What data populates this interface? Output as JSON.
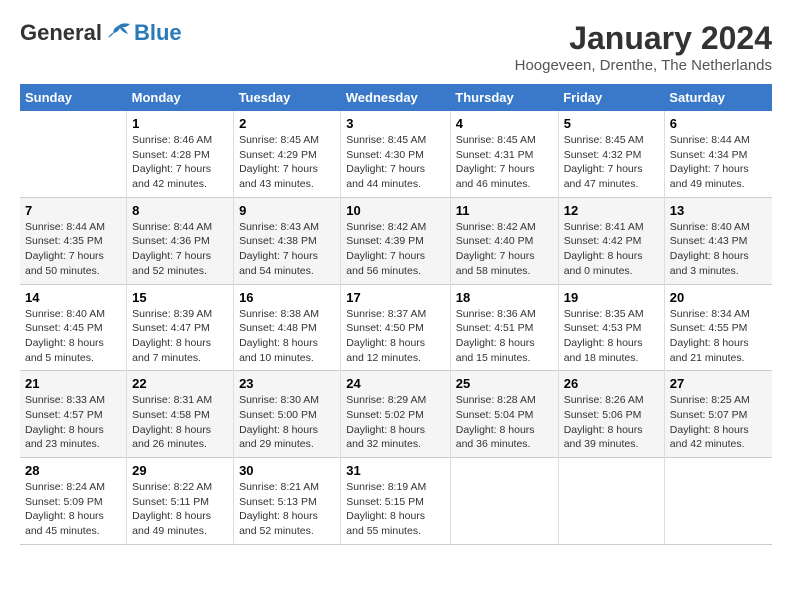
{
  "logo": {
    "general": "General",
    "blue": "Blue"
  },
  "header": {
    "month": "January 2024",
    "location": "Hoogeveen, Drenthe, The Netherlands"
  },
  "weekdays": [
    "Sunday",
    "Monday",
    "Tuesday",
    "Wednesday",
    "Thursday",
    "Friday",
    "Saturday"
  ],
  "weeks": [
    [
      {
        "day": "",
        "sunrise": "",
        "sunset": "",
        "daylight": ""
      },
      {
        "day": "1",
        "sunrise": "Sunrise: 8:46 AM",
        "sunset": "Sunset: 4:28 PM",
        "daylight": "Daylight: 7 hours and 42 minutes."
      },
      {
        "day": "2",
        "sunrise": "Sunrise: 8:45 AM",
        "sunset": "Sunset: 4:29 PM",
        "daylight": "Daylight: 7 hours and 43 minutes."
      },
      {
        "day": "3",
        "sunrise": "Sunrise: 8:45 AM",
        "sunset": "Sunset: 4:30 PM",
        "daylight": "Daylight: 7 hours and 44 minutes."
      },
      {
        "day": "4",
        "sunrise": "Sunrise: 8:45 AM",
        "sunset": "Sunset: 4:31 PM",
        "daylight": "Daylight: 7 hours and 46 minutes."
      },
      {
        "day": "5",
        "sunrise": "Sunrise: 8:45 AM",
        "sunset": "Sunset: 4:32 PM",
        "daylight": "Daylight: 7 hours and 47 minutes."
      },
      {
        "day": "6",
        "sunrise": "Sunrise: 8:44 AM",
        "sunset": "Sunset: 4:34 PM",
        "daylight": "Daylight: 7 hours and 49 minutes."
      }
    ],
    [
      {
        "day": "7",
        "sunrise": "Sunrise: 8:44 AM",
        "sunset": "Sunset: 4:35 PM",
        "daylight": "Daylight: 7 hours and 50 minutes."
      },
      {
        "day": "8",
        "sunrise": "Sunrise: 8:44 AM",
        "sunset": "Sunset: 4:36 PM",
        "daylight": "Daylight: 7 hours and 52 minutes."
      },
      {
        "day": "9",
        "sunrise": "Sunrise: 8:43 AM",
        "sunset": "Sunset: 4:38 PM",
        "daylight": "Daylight: 7 hours and 54 minutes."
      },
      {
        "day": "10",
        "sunrise": "Sunrise: 8:42 AM",
        "sunset": "Sunset: 4:39 PM",
        "daylight": "Daylight: 7 hours and 56 minutes."
      },
      {
        "day": "11",
        "sunrise": "Sunrise: 8:42 AM",
        "sunset": "Sunset: 4:40 PM",
        "daylight": "Daylight: 7 hours and 58 minutes."
      },
      {
        "day": "12",
        "sunrise": "Sunrise: 8:41 AM",
        "sunset": "Sunset: 4:42 PM",
        "daylight": "Daylight: 8 hours and 0 minutes."
      },
      {
        "day": "13",
        "sunrise": "Sunrise: 8:40 AM",
        "sunset": "Sunset: 4:43 PM",
        "daylight": "Daylight: 8 hours and 3 minutes."
      }
    ],
    [
      {
        "day": "14",
        "sunrise": "Sunrise: 8:40 AM",
        "sunset": "Sunset: 4:45 PM",
        "daylight": "Daylight: 8 hours and 5 minutes."
      },
      {
        "day": "15",
        "sunrise": "Sunrise: 8:39 AM",
        "sunset": "Sunset: 4:47 PM",
        "daylight": "Daylight: 8 hours and 7 minutes."
      },
      {
        "day": "16",
        "sunrise": "Sunrise: 8:38 AM",
        "sunset": "Sunset: 4:48 PM",
        "daylight": "Daylight: 8 hours and 10 minutes."
      },
      {
        "day": "17",
        "sunrise": "Sunrise: 8:37 AM",
        "sunset": "Sunset: 4:50 PM",
        "daylight": "Daylight: 8 hours and 12 minutes."
      },
      {
        "day": "18",
        "sunrise": "Sunrise: 8:36 AM",
        "sunset": "Sunset: 4:51 PM",
        "daylight": "Daylight: 8 hours and 15 minutes."
      },
      {
        "day": "19",
        "sunrise": "Sunrise: 8:35 AM",
        "sunset": "Sunset: 4:53 PM",
        "daylight": "Daylight: 8 hours and 18 minutes."
      },
      {
        "day": "20",
        "sunrise": "Sunrise: 8:34 AM",
        "sunset": "Sunset: 4:55 PM",
        "daylight": "Daylight: 8 hours and 21 minutes."
      }
    ],
    [
      {
        "day": "21",
        "sunrise": "Sunrise: 8:33 AM",
        "sunset": "Sunset: 4:57 PM",
        "daylight": "Daylight: 8 hours and 23 minutes."
      },
      {
        "day": "22",
        "sunrise": "Sunrise: 8:31 AM",
        "sunset": "Sunset: 4:58 PM",
        "daylight": "Daylight: 8 hours and 26 minutes."
      },
      {
        "day": "23",
        "sunrise": "Sunrise: 8:30 AM",
        "sunset": "Sunset: 5:00 PM",
        "daylight": "Daylight: 8 hours and 29 minutes."
      },
      {
        "day": "24",
        "sunrise": "Sunrise: 8:29 AM",
        "sunset": "Sunset: 5:02 PM",
        "daylight": "Daylight: 8 hours and 32 minutes."
      },
      {
        "day": "25",
        "sunrise": "Sunrise: 8:28 AM",
        "sunset": "Sunset: 5:04 PM",
        "daylight": "Daylight: 8 hours and 36 minutes."
      },
      {
        "day": "26",
        "sunrise": "Sunrise: 8:26 AM",
        "sunset": "Sunset: 5:06 PM",
        "daylight": "Daylight: 8 hours and 39 minutes."
      },
      {
        "day": "27",
        "sunrise": "Sunrise: 8:25 AM",
        "sunset": "Sunset: 5:07 PM",
        "daylight": "Daylight: 8 hours and 42 minutes."
      }
    ],
    [
      {
        "day": "28",
        "sunrise": "Sunrise: 8:24 AM",
        "sunset": "Sunset: 5:09 PM",
        "daylight": "Daylight: 8 hours and 45 minutes."
      },
      {
        "day": "29",
        "sunrise": "Sunrise: 8:22 AM",
        "sunset": "Sunset: 5:11 PM",
        "daylight": "Daylight: 8 hours and 49 minutes."
      },
      {
        "day": "30",
        "sunrise": "Sunrise: 8:21 AM",
        "sunset": "Sunset: 5:13 PM",
        "daylight": "Daylight: 8 hours and 52 minutes."
      },
      {
        "day": "31",
        "sunrise": "Sunrise: 8:19 AM",
        "sunset": "Sunset: 5:15 PM",
        "daylight": "Daylight: 8 hours and 55 minutes."
      },
      {
        "day": "",
        "sunrise": "",
        "sunset": "",
        "daylight": ""
      },
      {
        "day": "",
        "sunrise": "",
        "sunset": "",
        "daylight": ""
      },
      {
        "day": "",
        "sunrise": "",
        "sunset": "",
        "daylight": ""
      }
    ]
  ]
}
